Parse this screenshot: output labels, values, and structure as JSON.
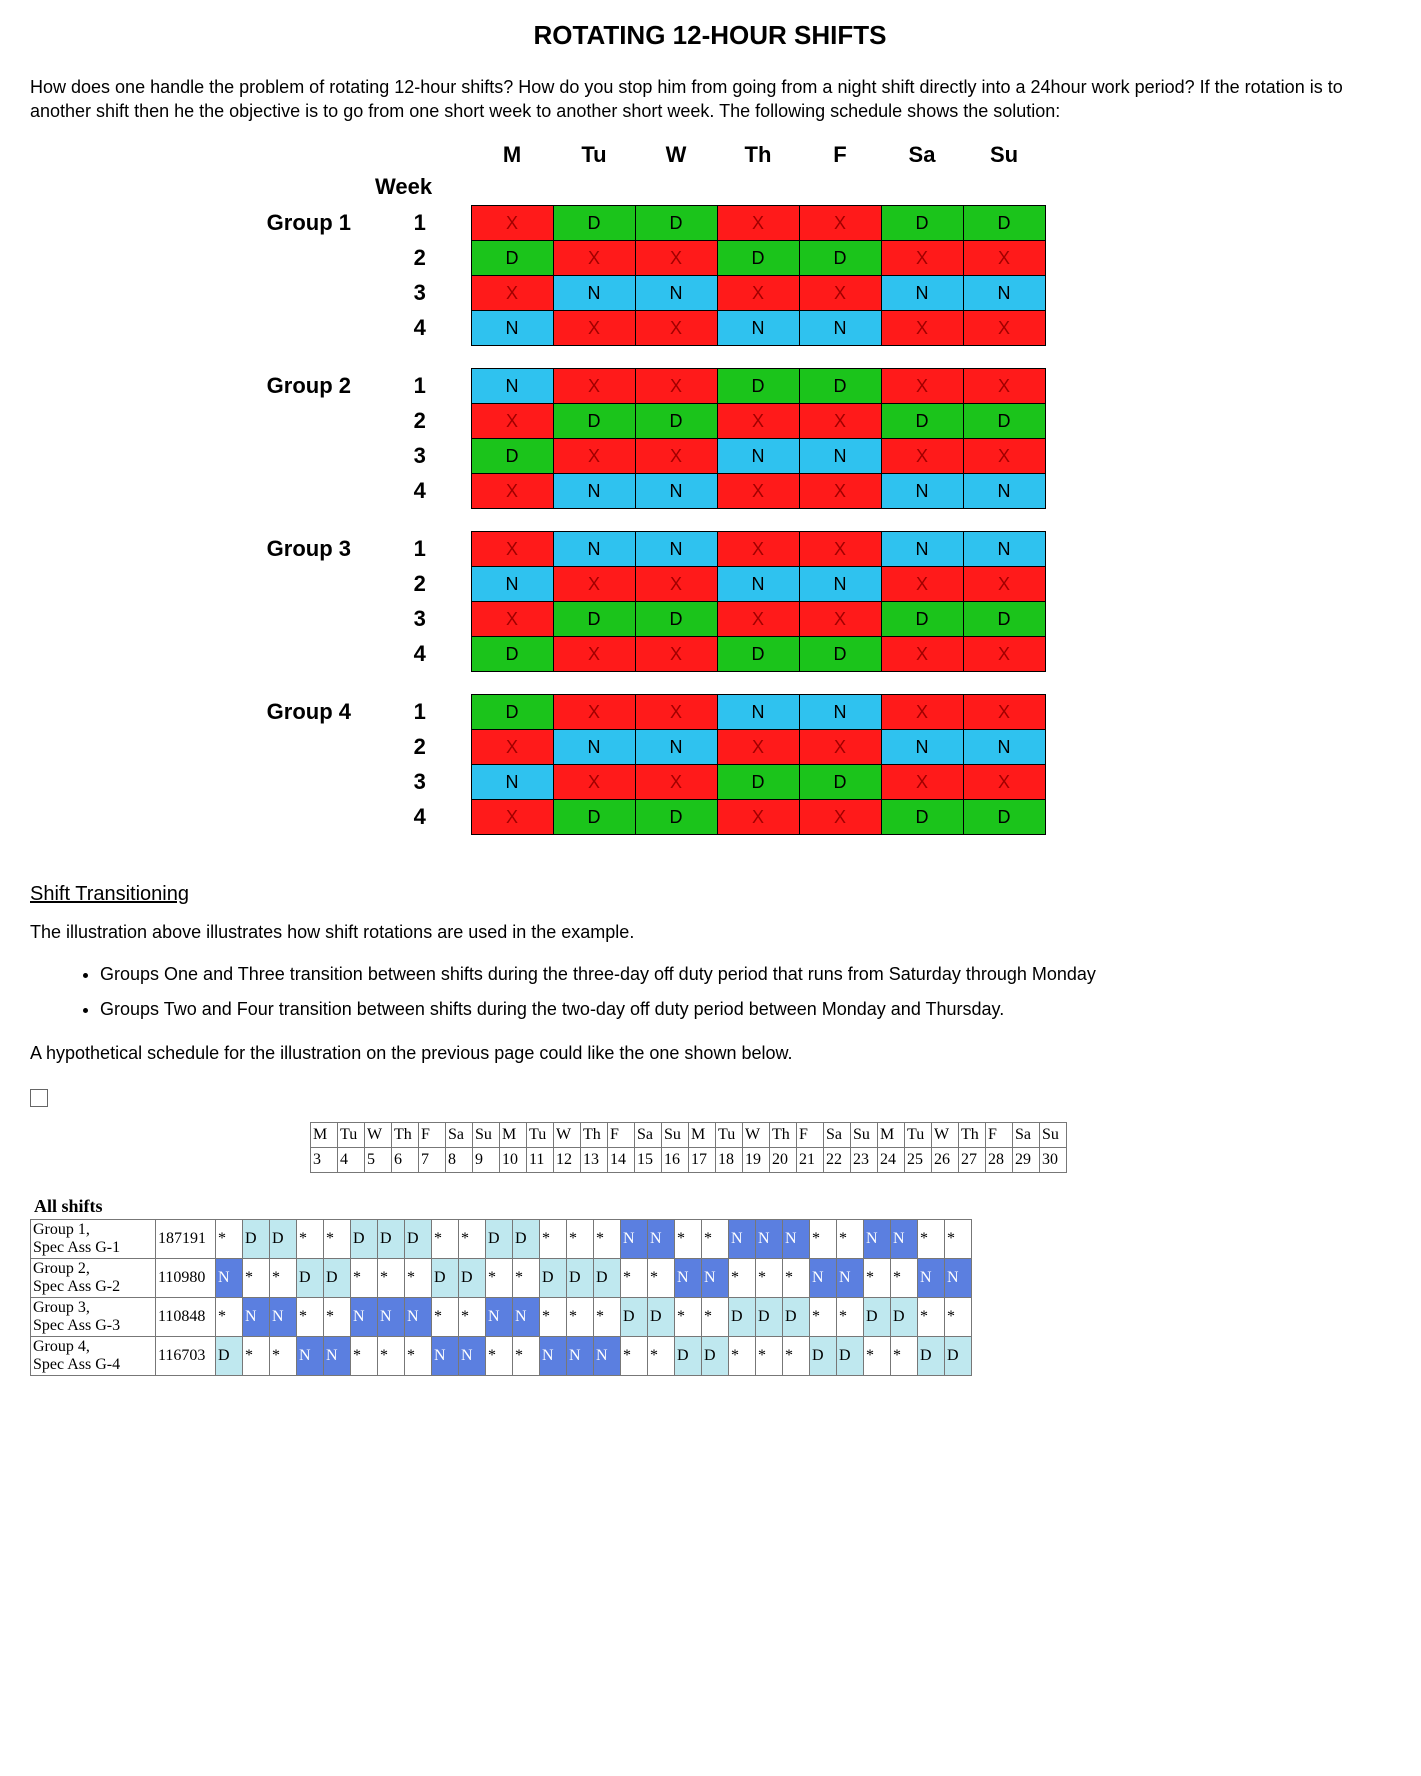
{
  "title": "ROTATING 12-HOUR SHIFTS",
  "intro": "How does one handle the problem of rotating 12-hour shifts? How do you stop him from going from a night shift directly into a 24hour work period?  If the rotation is to another shift then he the objective is to go from one short week to another short week. The following schedule shows the solution:",
  "days": [
    "M",
    "Tu",
    "W",
    "Th",
    "F",
    "Sa",
    "Su"
  ],
  "week_label": "Week",
  "group_names": [
    "Group 1",
    "Group 2",
    "Group 3",
    "Group 4"
  ],
  "week_nums": [
    "1",
    "2",
    "3",
    "4"
  ],
  "groups": [
    [
      [
        "X",
        "D",
        "D",
        "X",
        "X",
        "D",
        "D"
      ],
      [
        "D",
        "X",
        "X",
        "D",
        "D",
        "X",
        "X"
      ],
      [
        "X",
        "N",
        "N",
        "X",
        "X",
        "N",
        "N"
      ],
      [
        "N",
        "X",
        "X",
        "N",
        "N",
        "X",
        "X"
      ]
    ],
    [
      [
        "N",
        "X",
        "X",
        "D",
        "D",
        "X",
        "X"
      ],
      [
        "X",
        "D",
        "D",
        "X",
        "X",
        "D",
        "D"
      ],
      [
        "D",
        "X",
        "X",
        "N",
        "N",
        "X",
        "X"
      ],
      [
        "X",
        "N",
        "N",
        "X",
        "X",
        "N",
        "N"
      ]
    ],
    [
      [
        "X",
        "N",
        "N",
        "X",
        "X",
        "N",
        "N"
      ],
      [
        "N",
        "X",
        "X",
        "N",
        "N",
        "X",
        "X"
      ],
      [
        "X",
        "D",
        "D",
        "X",
        "X",
        "D",
        "D"
      ],
      [
        "D",
        "X",
        "X",
        "D",
        "D",
        "X",
        "X"
      ]
    ],
    [
      [
        "D",
        "X",
        "X",
        "N",
        "N",
        "X",
        "X"
      ],
      [
        "X",
        "N",
        "N",
        "X",
        "X",
        "N",
        "N"
      ],
      [
        "N",
        "X",
        "X",
        "D",
        "D",
        "X",
        "X"
      ],
      [
        "X",
        "D",
        "D",
        "X",
        "X",
        "D",
        "D"
      ]
    ]
  ],
  "shift_transition_heading": "Shift Transitioning",
  "illustration_note": "The illustration above illustrates how shift rotations are used in the example.",
  "bullets": [
    "Groups One and Three transition between shifts during the three-day off duty period that runs from Saturday through Monday",
    "Groups Two and Four transition between shifts during the two-day off duty period between Monday and Thursday."
  ],
  "hypo_note": "A hypothetical schedule for the illustration on the previous page could like the one shown below.",
  "cal_day_labels": [
    "M",
    "Tu",
    "W",
    "Th",
    "F",
    "Sa",
    "Su",
    "M",
    "Tu",
    "W",
    "Th",
    "F",
    "Sa",
    "Su",
    "M",
    "Tu",
    "W",
    "Th",
    "F",
    "Sa",
    "Su",
    "M",
    "Tu",
    "W",
    "Th",
    "F",
    "Sa",
    "Su"
  ],
  "cal_day_nums": [
    "3",
    "4",
    "5",
    "6",
    "7",
    "8",
    "9",
    "10",
    "11",
    "12",
    "13",
    "14",
    "15",
    "16",
    "17",
    "18",
    "19",
    "20",
    "21",
    "22",
    "23",
    "24",
    "25",
    "26",
    "27",
    "28",
    "29",
    "30"
  ],
  "all_shifts_label": "All shifts",
  "cal_rows": [
    {
      "label": "Group 1,",
      "sub": "Spec Ass  G-1",
      "num": "187191",
      "cells": [
        "*",
        "D",
        "D",
        "*",
        "*",
        "D",
        "D",
        "D",
        "*",
        "*",
        "D",
        "D",
        "*",
        "*",
        "*",
        "N",
        "N",
        "*",
        "*",
        "N",
        "N",
        "N",
        "*",
        "*",
        "N",
        "N",
        "*",
        "*"
      ],
      "style": [
        "",
        "lt",
        "lt",
        "",
        "",
        "lt",
        "lt",
        "lt",
        "",
        "",
        "lt",
        "lt",
        "",
        "",
        "",
        "b",
        "b",
        "",
        "",
        "b",
        "b",
        "b",
        "",
        "",
        "b",
        "b",
        "",
        ""
      ]
    },
    {
      "label": "Group 2,",
      "sub": "Spec Ass  G-2",
      "num": "110980",
      "cells": [
        "N",
        "*",
        "*",
        "D",
        "D",
        "*",
        "*",
        "*",
        "D",
        "D",
        "*",
        "*",
        "D",
        "D",
        "D",
        "*",
        "*",
        "N",
        "N",
        "*",
        "*",
        "*",
        "N",
        "N",
        "*",
        "*",
        "N",
        "N"
      ],
      "style": [
        "b",
        "",
        "",
        "lt",
        "lt",
        "",
        "",
        "",
        "lt",
        "lt",
        "",
        "",
        "lt",
        "lt",
        "lt",
        "",
        "",
        "b",
        "b",
        "",
        "",
        "",
        "b",
        "b",
        "",
        "",
        "b",
        "b"
      ]
    },
    {
      "label": "Group 3,",
      "sub": "Spec Ass  G-3",
      "num": "110848",
      "cells": [
        "*",
        "N",
        "N",
        "*",
        "*",
        "N",
        "N",
        "N",
        "*",
        "*",
        "N",
        "N",
        "*",
        "*",
        "*",
        "D",
        "D",
        "*",
        "*",
        "D",
        "D",
        "D",
        "*",
        "*",
        "D",
        "D",
        "*",
        "*"
      ],
      "style": [
        "",
        "b",
        "b",
        "",
        "",
        "b",
        "b",
        "b",
        "",
        "",
        "b",
        "b",
        "",
        "",
        "",
        "lt",
        "lt",
        "",
        "",
        "lt",
        "lt",
        "lt",
        "",
        "",
        "lt",
        "lt",
        "",
        ""
      ]
    },
    {
      "label": "Group 4,",
      "sub": "Spec Ass  G-4",
      "num": "116703",
      "cells": [
        "D",
        "*",
        "*",
        "N",
        "N",
        "*",
        "*",
        "*",
        "N",
        "N",
        "*",
        "*",
        "N",
        "N",
        "N",
        "*",
        "*",
        "D",
        "D",
        "*",
        "*",
        "*",
        "D",
        "D",
        "*",
        "*",
        "D",
        "D"
      ],
      "style": [
        "lt",
        "",
        "",
        "b",
        "b",
        "",
        "",
        "",
        "b",
        "b",
        "",
        "",
        "b",
        "b",
        "b",
        "",
        "",
        "lt",
        "lt",
        "",
        "",
        "",
        "lt",
        "lt",
        "",
        "",
        "lt",
        "lt"
      ]
    }
  ]
}
